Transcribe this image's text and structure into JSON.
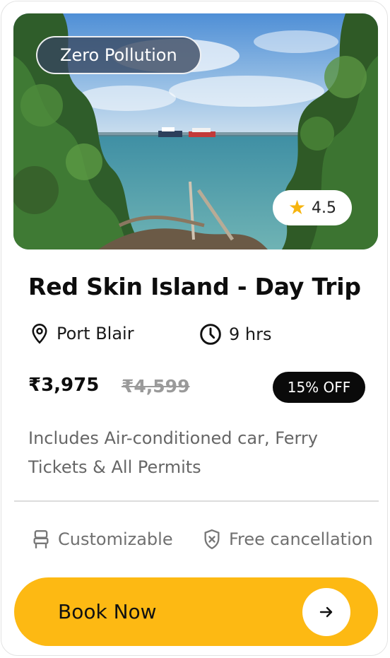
{
  "hero": {
    "badge": "Zero Pollution",
    "rating": "4.5"
  },
  "trip": {
    "title": "Red Skin Island - Day Trip",
    "location": "Port Blair",
    "duration": "9 hrs",
    "price": "₹3,975",
    "original_price": "₹4,599",
    "discount": "15% OFF",
    "description": "Includes Air-conditioned car, Ferry Tickets & All Permits"
  },
  "features": [
    {
      "label": "Customizable",
      "icon": "seat-icon"
    },
    {
      "label": "Free cancellation",
      "icon": "shield-x-icon"
    }
  ],
  "cta": {
    "label": "Book Now"
  },
  "colors": {
    "accent": "#fdb913",
    "discount_bg": "#0a0a0a",
    "star": "#f6b40e"
  }
}
